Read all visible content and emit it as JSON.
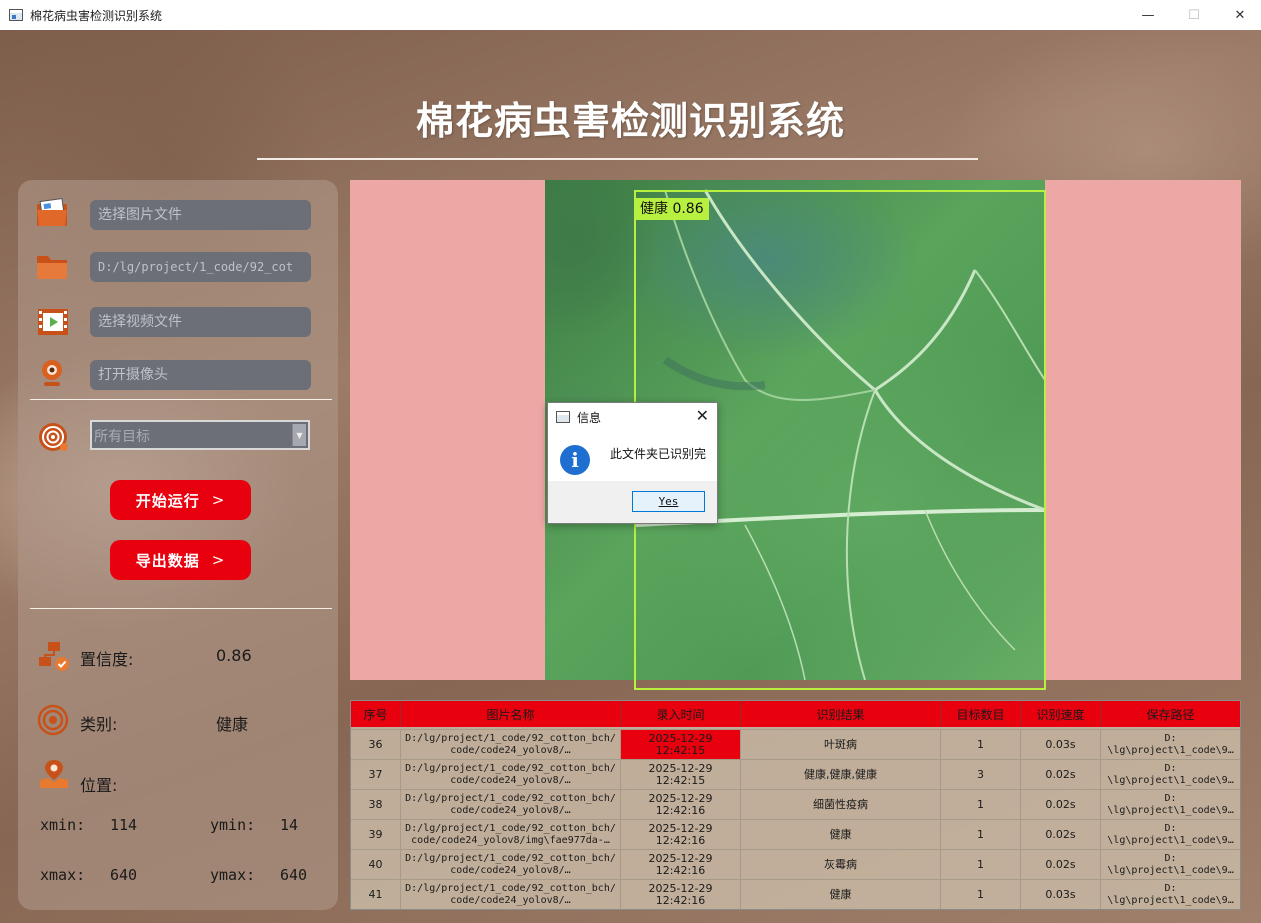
{
  "window": {
    "title": "棉花病虫害检测识别系统",
    "minimize": "—",
    "maximize": "☐",
    "close": "✕"
  },
  "header": {
    "title": "棉花病虫害检测识别系统"
  },
  "sidebar": {
    "image_field": {
      "placeholder": "选择图片文件"
    },
    "folder_field": {
      "value": "D:/lg/project/1_code/92_cot"
    },
    "video_field": {
      "placeholder": "选择视频文件"
    },
    "camera_field": {
      "placeholder": "打开摄像头"
    },
    "target_select": {
      "value": "所有目标",
      "arrow": "▼"
    },
    "start_button": {
      "label": "开始运行",
      "chevron": ">"
    },
    "export_button": {
      "label": "导出数据",
      "chevron": ">"
    },
    "confidence": {
      "label": "置信度:",
      "value": "0.86"
    },
    "category": {
      "label": "类别:",
      "value": "健康"
    },
    "position": {
      "label": "位置:"
    },
    "coords": {
      "xmin_label": "xmin:",
      "xmin": "114",
      "ymin_label": "ymin:",
      "ymin": "14",
      "xmax_label": "xmax:",
      "xmax": "640",
      "ymax_label": "ymax:",
      "ymax": "640"
    }
  },
  "detection": {
    "label": "健康 0.86",
    "box_color": "#b8f040"
  },
  "dialog": {
    "title": "信息",
    "message": "此文件夹已识别完",
    "icon": "i",
    "yes_label": "Yes",
    "close": "✕"
  },
  "table": {
    "headers": [
      "序号",
      "图片名称",
      "录入时间",
      "识别结果",
      "目标数目",
      "识别速度",
      "保存路径"
    ],
    "rows": [
      {
        "id": "36",
        "name_1": "D:/lg/project/1_code/92_cotton_bch/",
        "name_2": "code/code24_yolov8/…",
        "time_1": "2025-12-29",
        "time_2": "12:42:15",
        "result": "叶斑病",
        "count": "1",
        "speed": "0.03s",
        "path_1": "D:",
        "path_2": "\\lg\\project\\1_code\\9…"
      },
      {
        "id": "37",
        "name_1": "D:/lg/project/1_code/92_cotton_bch/",
        "name_2": "code/code24_yolov8/…",
        "time_1": "2025-12-29",
        "time_2": "12:42:15",
        "result": "健康,健康,健康",
        "count": "3",
        "speed": "0.02s",
        "path_1": "D:",
        "path_2": "\\lg\\project\\1_code\\9…"
      },
      {
        "id": "38",
        "name_1": "D:/lg/project/1_code/92_cotton_bch/",
        "name_2": "code/code24_yolov8/…",
        "time_1": "2025-12-29",
        "time_2": "12:42:16",
        "result": "细菌性疫病",
        "count": "1",
        "speed": "0.02s",
        "path_1": "D:",
        "path_2": "\\lg\\project\\1_code\\9…"
      },
      {
        "id": "39",
        "name_1": "D:/lg/project/1_code/92_cotton_bch/",
        "name_2": "code/code24_yolov8/img\\fae977da-…",
        "time_1": "2025-12-29",
        "time_2": "12:42:16",
        "result": "健康",
        "count": "1",
        "speed": "0.02s",
        "path_1": "D:",
        "path_2": "\\lg\\project\\1_code\\9…"
      },
      {
        "id": "40",
        "name_1": "D:/lg/project/1_code/92_cotton_bch/",
        "name_2": "code/code24_yolov8/…",
        "time_1": "2025-12-29",
        "time_2": "12:42:16",
        "result": "灰霉病",
        "count": "1",
        "speed": "0.02s",
        "path_1": "D:",
        "path_2": "\\lg\\project\\1_code\\9…"
      },
      {
        "id": "41",
        "name_1": "D:/lg/project/1_code/92_cotton_bch/",
        "name_2": "code/code24_yolov8/…",
        "time_1": "2025-12-29",
        "time_2": "12:42:16",
        "result": "健康",
        "count": "1",
        "speed": "0.03s",
        "path_1": "D:",
        "path_2": "\\lg\\project\\1_code\\9…"
      }
    ]
  },
  "colors": {
    "accent_red": "#e8000f",
    "image_bg": "#eda8a5",
    "field_bg": "#6c6f78"
  }
}
